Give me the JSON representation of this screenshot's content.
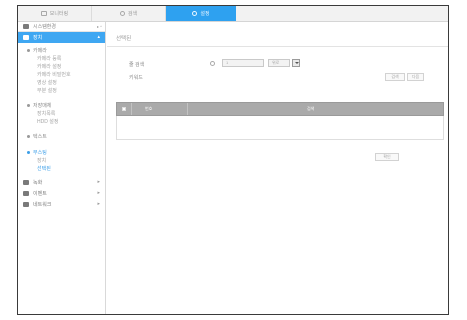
{
  "tabs": [
    {
      "label": "모니터링",
      "icon": "monitor-icon",
      "active": false
    },
    {
      "label": "검색",
      "icon": "search-icon",
      "active": false
    },
    {
      "label": "설정",
      "icon": "gear-icon",
      "active": true
    }
  ],
  "sidebar": {
    "system_label": "시스템환경",
    "system_arrows": "▸ ^",
    "active_label": "장치",
    "sections": [
      {
        "label": "카메라",
        "items": [
          "카메라 등록",
          "카메라 설정",
          "카메라 비밀번호",
          "영상 설정",
          "부분 설정"
        ]
      },
      {
        "label": "저장매체",
        "items": [
          "장치목록",
          "HDD 설정"
        ]
      },
      {
        "label": "텍스트",
        "items": []
      },
      {
        "label": "부스팅",
        "items": [
          "장치",
          "선택된"
        ],
        "selected_index": 1
      }
    ],
    "groups": [
      {
        "label": "녹화",
        "icon": "record-icon"
      },
      {
        "label": "이벤트",
        "icon": "event-icon"
      },
      {
        "label": "네트워크",
        "icon": "network-icon"
      }
    ]
  },
  "main": {
    "title": "선택된",
    "field1_label": "줄 검색",
    "field1_value": "1",
    "unit_value": "위로",
    "field2_label": "키워드",
    "btn_top_1": "검색",
    "btn_top_2": "다음",
    "table_headers": [
      "번호",
      "검색"
    ],
    "apply_button": "확인"
  }
}
